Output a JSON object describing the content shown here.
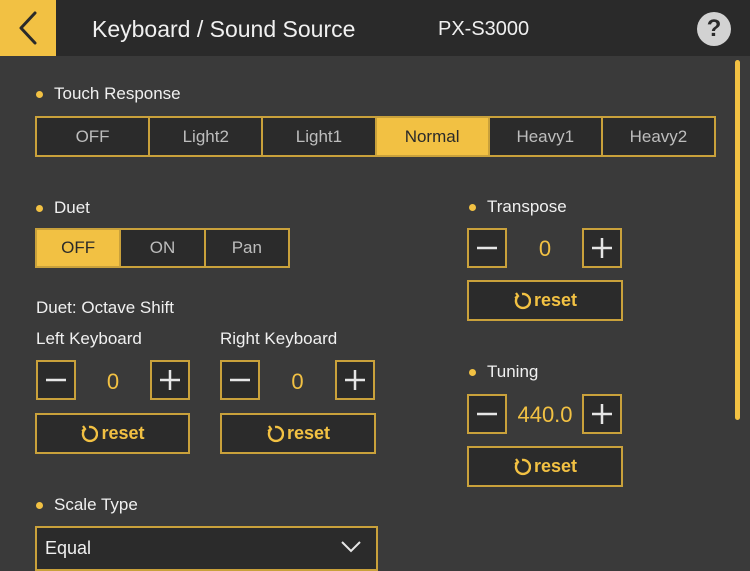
{
  "header": {
    "title": "Keyboard / Sound Source",
    "model": "PX-S3000",
    "back_icon": "chevron-left-icon",
    "help_label": "?"
  },
  "colors": {
    "accent": "#f2c143",
    "header_bg": "#2a2a2a",
    "body_bg": "#3a3a3a",
    "button_bg": "#2b2b2b"
  },
  "touch_response": {
    "label": "Touch Response",
    "options": [
      "OFF",
      "Light2",
      "Light1",
      "Normal",
      "Heavy1",
      "Heavy2"
    ],
    "selected": "Normal"
  },
  "duet": {
    "label": "Duet",
    "options": [
      "OFF",
      "ON",
      "Pan"
    ],
    "selected": "OFF"
  },
  "octave_shift": {
    "label": "Duet: Octave Shift",
    "left": {
      "label": "Left Keyboard",
      "value": "0",
      "reset_label": "reset"
    },
    "right": {
      "label": "Right Keyboard",
      "value": "0",
      "reset_label": "reset"
    }
  },
  "transpose": {
    "label": "Transpose",
    "value": "0",
    "reset_label": "reset"
  },
  "tuning": {
    "label": "Tuning",
    "value": "440.0",
    "reset_label": "reset"
  },
  "scale_type": {
    "label": "Scale Type",
    "value": "Equal"
  }
}
